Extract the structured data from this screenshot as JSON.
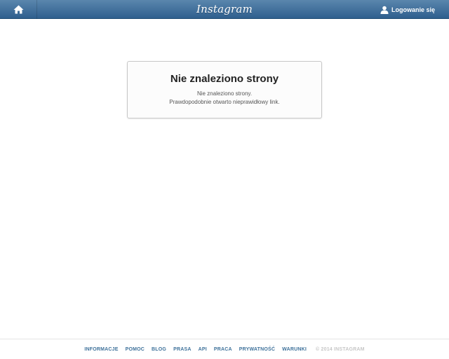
{
  "header": {
    "logo": "Instagram",
    "login_label": "Logowanie się",
    "home_icon": "home-icon",
    "user_icon": "user-icon"
  },
  "error": {
    "title": "Nie znaleziono strony",
    "line1": "Nie znaleziono strony.",
    "line2": "Prawdopodobnie otwarto nieprawidłowy link."
  },
  "footer": {
    "links": [
      "INFORMACJE",
      "POMOC",
      "BLOG",
      "PRASA",
      "API",
      "PRACA",
      "PRYWATNOŚĆ",
      "WARUNKI"
    ],
    "copyright": "© 2014 INSTAGRAM"
  },
  "colors": {
    "header_top": "#5a86ad",
    "header_bottom": "#2f5f8e",
    "footer_link": "#3f729b"
  }
}
